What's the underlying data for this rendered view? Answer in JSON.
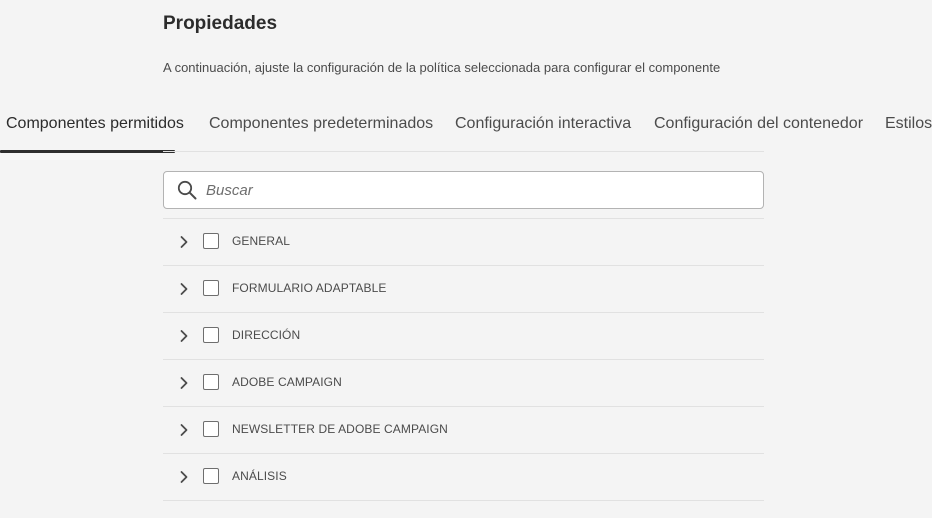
{
  "header": {
    "title": "Propiedades",
    "description": "A continuación, ajuste la configuración de la política seleccionada para configurar el componente"
  },
  "tabs": [
    {
      "label": "Componentes permitidos",
      "active": true
    },
    {
      "label": "Componentes predeterminados",
      "active": false
    },
    {
      "label": "Configuración interactiva",
      "active": false
    },
    {
      "label": "Configuración del contenedor",
      "active": false
    },
    {
      "label": "Estilos",
      "active": false
    }
  ],
  "search": {
    "placeholder": "Buscar",
    "value": ""
  },
  "groups": [
    {
      "label": "GENERAL",
      "checked": false,
      "expanded": false
    },
    {
      "label": "FORMULARIO ADAPTABLE",
      "checked": false,
      "expanded": false
    },
    {
      "label": "DIRECCIÓN",
      "checked": false,
      "expanded": false
    },
    {
      "label": "ADOBE CAMPAIGN",
      "checked": false,
      "expanded": false
    },
    {
      "label": "NEWSLETTER DE ADOBE CAMPAIGN",
      "checked": false,
      "expanded": false
    },
    {
      "label": "ANÁLISIS",
      "checked": false,
      "expanded": false
    }
  ],
  "colors": {
    "background": "#f4f4f4",
    "text": "#2c2c2c",
    "secondary_text": "#4b4b4b",
    "divider": "#e1e1e1",
    "active_tab_underline": "#2c2c2c"
  },
  "icons": {
    "search": "search-icon",
    "expand": "chevron-right-icon",
    "checkbox": "checkbox-unchecked"
  }
}
